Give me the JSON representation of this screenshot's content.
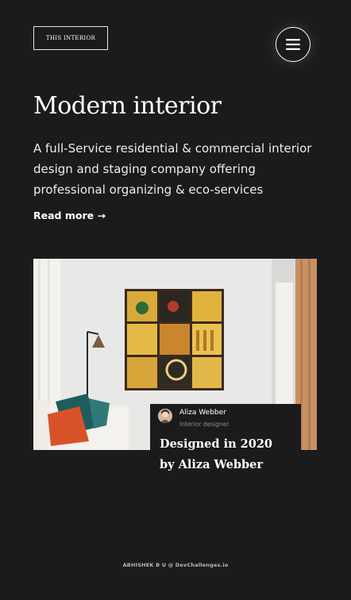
{
  "header": {
    "logo_text": "THIS INTERIOR",
    "menu_icon": "hamburger-icon"
  },
  "hero": {
    "title": "Modern interior",
    "description": "A full-Service residential & commercial interior design and staging company offering professional organizing & eco-services",
    "read_more": "Read more →"
  },
  "feature": {
    "image_subject": "living room with framed yellow art grid, floor lamp and sofa with teal and orange cushions",
    "author_name": "Aliza Webber",
    "author_role": "Interior designer",
    "title": "Designed in 2020 by Aliza Webber"
  },
  "footer": {
    "credit": "ABHISHEK B U @ DevChallenges.io"
  },
  "colors": {
    "background": "#1b1b1d",
    "text": "#ffffff",
    "muted": "#8d8d90"
  }
}
